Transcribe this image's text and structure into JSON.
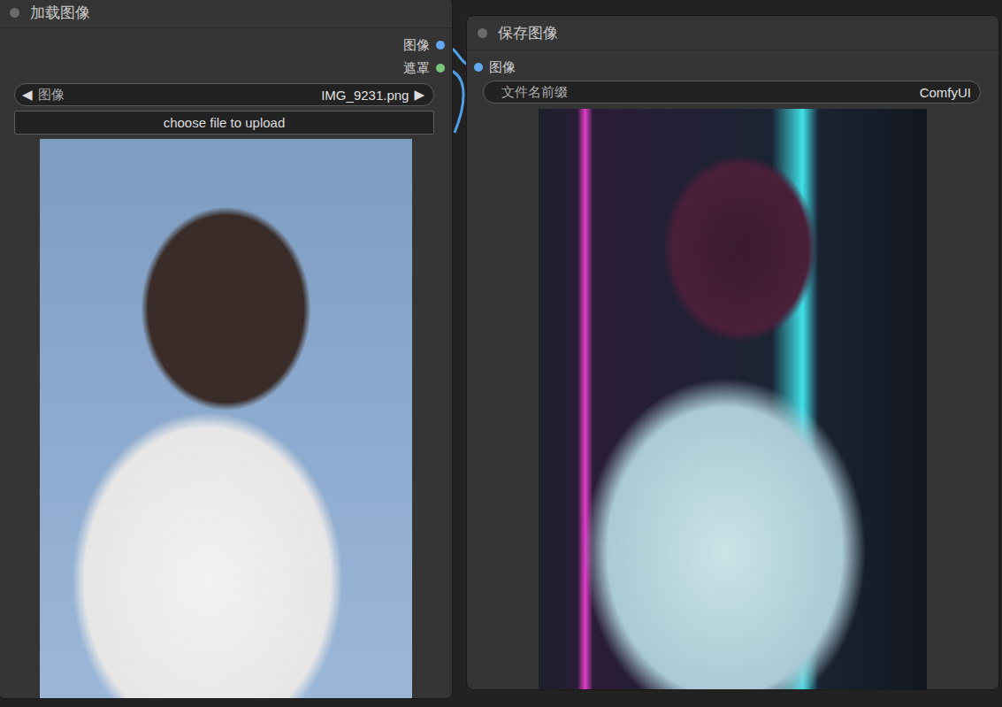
{
  "load_image_node": {
    "title": "加载图像",
    "outputs": [
      {
        "label": "图像",
        "color": "#64a8f0"
      },
      {
        "label": "遮罩",
        "color": "#7bc67e"
      }
    ],
    "image_widget": {
      "prev": "◀",
      "label": "图像",
      "value": "IMG_9231.png",
      "next": "▶"
    },
    "upload_button": "choose file to upload"
  },
  "save_image_node": {
    "title": "保存图像",
    "inputs": [
      {
        "label": "图像",
        "color": "#64a8f0"
      }
    ],
    "prefix_widget": {
      "label": "文件名前缀",
      "value": "ComfyUI"
    }
  }
}
